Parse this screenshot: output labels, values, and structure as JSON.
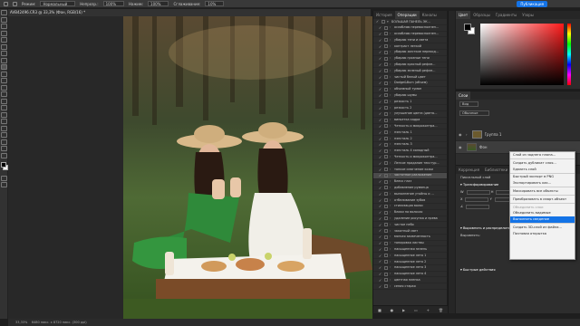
{
  "options_bar": {
    "mode_label": "Режим:",
    "mode_value": "Нормальный",
    "opacity_label": "Непрозр.:",
    "opacity_value": "100%",
    "flow_label": "Нажим:",
    "flow_value": "100%",
    "smoothing_label": "Сглаживание:",
    "smoothing_value": "10%",
    "publish_label": "Публикация"
  },
  "document": {
    "tab_title": "AVB42496.CR3 @ 33,3% (Фон, RGB/16) *"
  },
  "status": {
    "zoom": "33,33%",
    "size_info": "6480 пикс. x 8720 пикс. (300 ppi)"
  },
  "actions_panel": {
    "tabs": [
      "История",
      "Операции",
      "Каналы"
    ],
    "active_tab": "Операции",
    "items": [
      {
        "label": "БОЛЬШАЯ ПАНЕЛЬ ЭК...",
        "selected": false
      },
      {
        "label": "ослабляю перевосполнен...",
        "selected": false
      },
      {
        "label": "ослабляю перевосполнен...",
        "selected": false
      },
      {
        "label": "убираю тени и света",
        "selected": false
      },
      {
        "label": "контраст легкий",
        "selected": false
      },
      {
        "label": "убираю жесткие переход...",
        "selected": false
      },
      {
        "label": "убираю грязные тени",
        "selected": false
      },
      {
        "label": "убираю красный рефле...",
        "selected": false
      },
      {
        "label": "убираю зеленый рефле...",
        "selected": false
      },
      {
        "label": "чистый белый цвет",
        "selected": false
      },
      {
        "label": "Dodge&Burn (объем)",
        "selected": false
      },
      {
        "label": "объемный туман",
        "selected": false
      },
      {
        "label": "убираю шумы",
        "selected": false
      },
      {
        "label": "резкость 1",
        "selected": false
      },
      {
        "label": "резкость 2",
        "selected": false
      },
      {
        "label": "улучшение цвета (цвето...",
        "selected": false
      },
      {
        "label": "виньетка кадра",
        "selected": false
      },
      {
        "label": "Четкость и микроконтра...",
        "selected": false
      },
      {
        "label": "нэнсталь 1",
        "selected": false
      },
      {
        "label": "нэнсталь 2",
        "selected": false
      },
      {
        "label": "нэнсталь 3",
        "selected": false
      },
      {
        "label": "нэнсталь 4 холодный",
        "selected": false
      },
      {
        "label": "Четкость и микроконтра...",
        "selected": false
      },
      {
        "label": "Легкое придание текстур...",
        "selected": false
      },
      {
        "label": "тонкое смягчение кожи",
        "selected": false
      },
      {
        "label": "частотное разложение",
        "selected": true
      },
      {
        "label": "блеск глаз",
        "selected": false
      },
      {
        "label": "добавление румянца",
        "selected": false
      },
      {
        "label": "выполнение утойны и ...",
        "selected": false
      },
      {
        "label": "отбеливание зубов",
        "selected": false
      },
      {
        "label": "стилизация волос",
        "selected": false
      },
      {
        "label": "блики на волосах",
        "selected": false
      },
      {
        "label": "удаление рисунка и прева",
        "selected": false
      },
      {
        "label": "чистое небо",
        "selected": false
      },
      {
        "label": "закатный свет",
        "selected": false
      },
      {
        "label": "мягкая засвеченность",
        "selected": false
      },
      {
        "label": "тонировка листвы",
        "selected": false
      },
      {
        "label": "насыщенная зелень",
        "selected": false
      },
      {
        "label": "насыщенное лето 1",
        "selected": false
      },
      {
        "label": "насыщенное лето 2",
        "selected": false
      },
      {
        "label": "насыщенное лето 3",
        "selected": false
      },
      {
        "label": "насыщенное лето 4",
        "selected": false
      },
      {
        "label": "цветная пленка",
        "selected": false
      },
      {
        "label": "сепия старая",
        "selected": false
      }
    ]
  },
  "color_panel": {
    "tabs": [
      "Цвет",
      "Образцы",
      "Градиенты",
      "Узоры"
    ],
    "active_tab": "Цвет",
    "foreground": "#000000",
    "background": "#ffffff"
  },
  "layers_panel": {
    "title": "Слои",
    "filter_placeholder": "Вид",
    "blend": "Обычные",
    "layers": [
      {
        "name": "Группа 1",
        "kind": "group"
      },
      {
        "name": "Фон",
        "kind": "background"
      }
    ]
  },
  "properties_panel": {
    "tabs": [
      "Коррекция",
      "Библиотеки",
      "Свойства"
    ],
    "layer_kind": "Пиксельный слой",
    "sections": [
      {
        "title": "Трансформирование"
      },
      {
        "title": "Выровнять и распределить"
      },
      {
        "title": "Выровнять:"
      },
      {
        "title": "Быстрые действия"
      }
    ]
  },
  "context_menu": {
    "items": [
      {
        "label": "Слой из заднего плана...",
        "state": "normal"
      },
      {
        "label": "sep",
        "state": "sep"
      },
      {
        "label": "Создать дубликат слоя...",
        "state": "normal"
      },
      {
        "label": "Удалить слой",
        "state": "normal"
      },
      {
        "label": "sep",
        "state": "sep"
      },
      {
        "label": "Быстрый экспорт в PNG",
        "state": "normal"
      },
      {
        "label": "Экспортировать как...",
        "state": "normal"
      },
      {
        "label": "sep",
        "state": "sep"
      },
      {
        "label": "Маскировать все объекты",
        "state": "normal"
      },
      {
        "label": "sep",
        "state": "sep"
      },
      {
        "label": "Преобразовать в смарт-объект",
        "state": "normal"
      },
      {
        "label": "sep",
        "state": "sep"
      },
      {
        "label": "Объединить слои",
        "state": "disabled"
      },
      {
        "label": "Объединить видимые",
        "state": "normal"
      },
      {
        "label": "Выполнить сведение",
        "state": "highlighted"
      },
      {
        "label": "sep",
        "state": "sep"
      },
      {
        "label": "Создать 3D-слой из файла...",
        "state": "normal"
      },
      {
        "label": "Почтовая открытка",
        "state": "normal"
      }
    ]
  },
  "colors": {
    "accent": "#1473e6",
    "panel": "#2d2d2d",
    "app_bg": "#1e1e1e"
  }
}
